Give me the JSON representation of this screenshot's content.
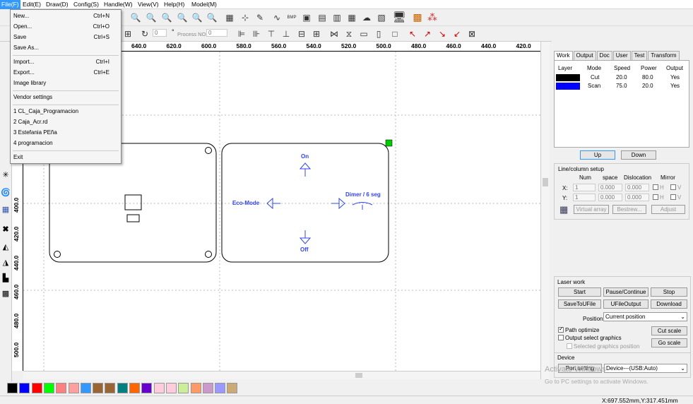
{
  "menubar": [
    {
      "label": "File(F)"
    },
    {
      "label": "Edit(E)"
    },
    {
      "label": "Draw(D)"
    },
    {
      "label": "Config(S)"
    },
    {
      "label": "Handle(W)"
    },
    {
      "label": "View(V)"
    },
    {
      "label": "Help(H)"
    },
    {
      "label": "Model(M)"
    }
  ],
  "file_menu": {
    "items": [
      {
        "label": "New...",
        "shortcut": "Ctrl+N"
      },
      {
        "label": "Open...",
        "shortcut": "Ctrl+O"
      },
      {
        "label": "Save",
        "shortcut": "Ctrl+S"
      },
      {
        "label": "Save As...",
        "shortcut": ""
      },
      {
        "label": "Import...",
        "shortcut": "Ctrl+I"
      },
      {
        "label": "Export...",
        "shortcut": "Ctrl+E"
      },
      {
        "label": "Image library",
        "shortcut": ""
      },
      {
        "label": "Vendor settings",
        "shortcut": ""
      },
      {
        "label": "1 CL_Caja_Programacion",
        "shortcut": ""
      },
      {
        "label": "2 Caja_Acr.rd",
        "shortcut": ""
      },
      {
        "label": "3 Estefania PEña",
        "shortcut": ""
      },
      {
        "label": "4 programacion",
        "shortcut": ""
      },
      {
        "label": "Exit",
        "shortcut": ""
      }
    ]
  },
  "toolbar2": {
    "angle_value": "0",
    "degree": "°",
    "process_no_label": "Process NO:",
    "process_no_value": "0"
  },
  "ruler_h": [
    "640.0",
    "620.0",
    "600.0",
    "580.0",
    "560.0",
    "540.0",
    "520.0",
    "500.0",
    "480.0",
    "460.0",
    "440.0",
    "420.0"
  ],
  "ruler_v": [
    "400.0",
    "420.0",
    "440.0",
    "460.0",
    "480.0",
    "500.0"
  ],
  "canvas": {
    "labels": {
      "on": "On",
      "off": "Off",
      "eco": "Eco-Mode",
      "dimer": "Dimer / 6 seg"
    },
    "accent_color": "#3344ee"
  },
  "palette": [
    "#000000",
    "#0000ff",
    "#ff0000",
    "#00ff00",
    "#ff8080",
    "#ffa0a0",
    "#3399ff",
    "#996633",
    "#996633",
    "#008080",
    "#ff6600",
    "#6600cc",
    "#ffccdd",
    "#ffccdd",
    "#ccee99",
    "#ff9966",
    "#cc99cc",
    "#9999ff",
    "#ccaa77"
  ],
  "right_panel": {
    "tabs": [
      "Work",
      "Output",
      "Doc",
      "User",
      "Test",
      "Transform"
    ],
    "layer_headers": [
      "Layer",
      "Mode",
      "Speed",
      "Power",
      "Output"
    ],
    "layers": [
      {
        "color": "#000000",
        "mode": "Cut",
        "speed": "20.0",
        "power": "80.0",
        "output": "Yes"
      },
      {
        "color": "#0000ff",
        "mode": "Scan",
        "speed": "75.0",
        "power": "20.0",
        "output": "Yes"
      }
    ],
    "up_label": "Up",
    "down_label": "Down",
    "line_column": {
      "title": "Line/column setup",
      "headers": [
        "Num",
        "space",
        "Dislocation",
        "Mirror"
      ],
      "x_label": "X:",
      "y_label": "Y:",
      "x_num": "1",
      "x_space": "0.000",
      "x_disloc": "0.000",
      "y_num": "1",
      "y_space": "0.000",
      "y_disloc": "0.000",
      "h": "H",
      "v": "V",
      "virtual_array": "Virtual array",
      "bestrew": "Bestrew...",
      "adjust": "Adjust"
    },
    "laser_work": {
      "title": "Laser work",
      "start": "Start",
      "pause": "Pause/Continue",
      "stop": "Stop",
      "save_u": "SaveToUFile",
      "ufile_output": "UFileOutput",
      "download": "Download",
      "position_label": "Position:",
      "position_value": "Current position",
      "path_optimize": "Path optimize",
      "output_select": "Output select graphics",
      "selected_pos": "Selected graphics position",
      "cut_scale": "Cut scale",
      "go_scale": "Go scale"
    },
    "device": {
      "title": "Device",
      "port_setting": "Port setting",
      "device_value": "Device---(USB:Auto)"
    }
  },
  "watermark": {
    "line1": "Activate Windows",
    "line2": "Go to PC settings to activate Windows."
  },
  "status": {
    "coord": "X:697.552mm,Y:317.451mm"
  }
}
